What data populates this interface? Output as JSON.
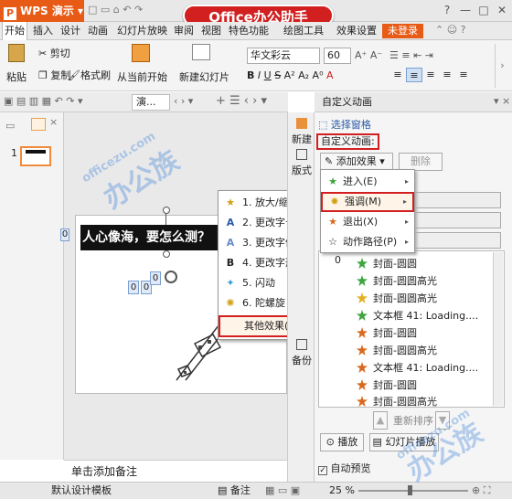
{
  "window": {
    "app_title": "WPS 演示",
    "brand_banner": "Office办公助手",
    "controls": [
      "?",
      "—",
      "□",
      "✕"
    ]
  },
  "menubar": {
    "items": [
      "开始",
      "插入",
      "设计",
      "动画",
      "幻灯片放映",
      "审阅",
      "视图",
      "特色功能",
      "绘图工具",
      "效果设置"
    ],
    "login": "未登录"
  },
  "ribbon": {
    "paste": "粘贴",
    "cut": "剪切",
    "copy": "复制",
    "format_painter": "格式刷",
    "from_current": "从当前开始",
    "new_slide": "新建幻灯片",
    "font_name": "华文彩云",
    "font_size": "60"
  },
  "tabs": {
    "doc_tab": "演..."
  },
  "slides": {
    "number": "1",
    "title_text": "人心像海，要怎么测？",
    "label_zero_left": "0",
    "box1": "0",
    "box2": "0",
    "box3": "0"
  },
  "notes": {
    "placeholder": "单击添加备注"
  },
  "sidebar": {
    "new": "新建",
    "layout": "版式",
    "backup": "备份"
  },
  "task_pane": {
    "header": "自定义动画",
    "select_pane": "选择窗格",
    "section_label": "自定义动画:",
    "add_effect": "添加效果",
    "delete": "删除",
    "list_number": "0",
    "list": [
      {
        "icon": "green",
        "text": "封面-圆圆"
      },
      {
        "icon": "green",
        "text": "封面-圆圆高光"
      },
      {
        "icon": "yellow",
        "text": "封面-圆圆高光"
      },
      {
        "icon": "green",
        "text": "文本框 41: Loading...."
      },
      {
        "icon": "orange",
        "text": "封面-圆圆"
      },
      {
        "icon": "orange",
        "text": "封面-圆圆高光"
      },
      {
        "icon": "orange",
        "text": "文本框 41: Loading...."
      },
      {
        "icon": "orange",
        "text": "封面-圆圆"
      },
      {
        "icon": "orange",
        "text": "封面-圆圆高光"
      }
    ],
    "reorder": "重新排序",
    "play": "播放",
    "slideshow": "幻灯片播放",
    "auto_preview": "自动预览"
  },
  "menu_effects": {
    "items": [
      "1. 放大/缩小",
      "2. 更改字号",
      "3. 更改字体",
      "4. 更改字形",
      "5. 闪动",
      "6. 陀螺旋"
    ],
    "more": "其他效果(M)..."
  },
  "menu_add": {
    "items": [
      "进入(E)",
      "强调(M)",
      "退出(X)",
      "动作路径(P)"
    ]
  },
  "statusbar": {
    "template": "默认设计模板",
    "notes": "备注",
    "zoom": "25 %"
  },
  "watermarks": {
    "site": "officezu.com",
    "mark": "办公族"
  },
  "colors": {
    "accent_orange": "#e85b17",
    "highlight_red": "#d21f1f"
  }
}
